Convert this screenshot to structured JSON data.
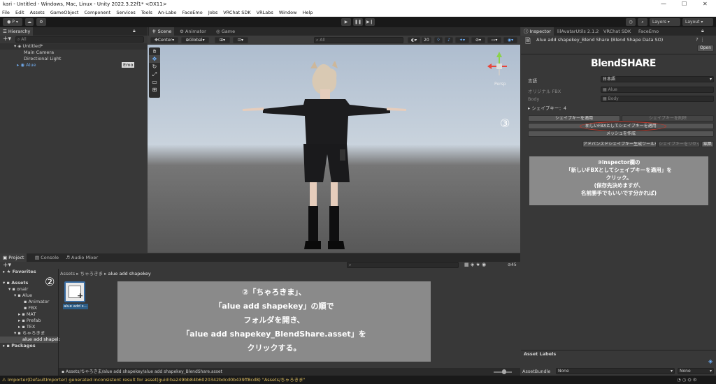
{
  "window": {
    "title": "kari - Untitled - Windows, Mac, Linux - Unity 2022.3.22f1* <DX11>",
    "min": "—",
    "max": "☐",
    "close": "✕"
  },
  "menu": [
    "File",
    "Edit",
    "Assets",
    "GameObject",
    "Component",
    "Services",
    "Tools",
    "An-Labo",
    "FaceEmo",
    "Jobs",
    "VRChat SDK",
    "VRLabs",
    "Window",
    "Help"
  ],
  "toolbar": {
    "layers": "Layers",
    "layout": "Layout"
  },
  "hierarchy": {
    "tab": "Hierarchy",
    "search_placeholder": "All",
    "scene": "Untitled*",
    "items": [
      "Main Camera",
      "Directional Light",
      "Alue"
    ],
    "badge": "Emo"
  },
  "scene": {
    "tabs": [
      "Scene",
      "Animator",
      "Game"
    ],
    "pivot": "Center",
    "space": "Global",
    "search_placeholder": "All",
    "grid_size": "20",
    "gizmo_label": "Persp"
  },
  "inspector": {
    "tabs": [
      "Inspector",
      "lilAvatarUtils 2.1.2",
      "VRChat SDK",
      "FaceEmo"
    ],
    "asset_title": "Alue add shapekey_Blend Share (Blend Shape Data SO)",
    "open_button": "Open",
    "logo": "BlendSHARE",
    "rows": [
      {
        "label": "言語",
        "value": "日本語"
      },
      {
        "label": "オリジナル FBX",
        "value": "Alue"
      },
      {
        "label": "Body",
        "value": "Body"
      }
    ],
    "shapekey_count": "シェイプキー：4",
    "buttons": {
      "apply": "シェイプキーを適用",
      "remove": "シェイプキーを削除",
      "new_fbx": "新しいFBXとしてシェイプキーを適用",
      "mesh": "メッシュを作成",
      "advanced": "アドバンスドシェイプキー生成ツールを開く",
      "reset": "シェイプキーをリセット",
      "edit": "編集"
    },
    "asset_labels": "Asset Labels",
    "asset_bundle": "AssetBundle",
    "bundle_value": "None",
    "bundle_variant": "None"
  },
  "annotations": {
    "num3": "③",
    "note3": [
      "③inspector欄の",
      "「新しいFBXとしてシェイプキーを適用」を",
      "クリック。",
      "(保存先決めますが、",
      "名前勝手でもいいです分かれば)"
    ],
    "num2": "②",
    "note2": [
      "②「ちゃろきま」、",
      "「alue add shapekey」の順で",
      "フォルダを開き、",
      "「alue add shapekey_BlendShare.asset」を",
      "クリックする。"
    ]
  },
  "project": {
    "tabs": [
      "Project",
      "Console",
      "Audio Mixer"
    ],
    "favorites": "Favorites",
    "assets": "Assets",
    "folders": [
      "onair",
      "Alue",
      "Animator",
      "FBX",
      "MAT",
      "Prefab",
      "TEX",
      "ちゃろきま",
      "alue add shapek"
    ],
    "packages": "Packages",
    "breadcrumb": [
      "Assets",
      "ちゃろきま",
      "alue add shapekey"
    ],
    "asset_name": "alue add s...",
    "path": "Assets/ちゃろきま/alue add shapekey/alue add shapekey_BlendShare.asset",
    "count": "45"
  },
  "status": "Importer(DefaultImporter) generated inconsistent result for asset(guid:ba249bb84b6020342bdcd0b439ff8cd8) \"Assets/ちゃろきま\""
}
